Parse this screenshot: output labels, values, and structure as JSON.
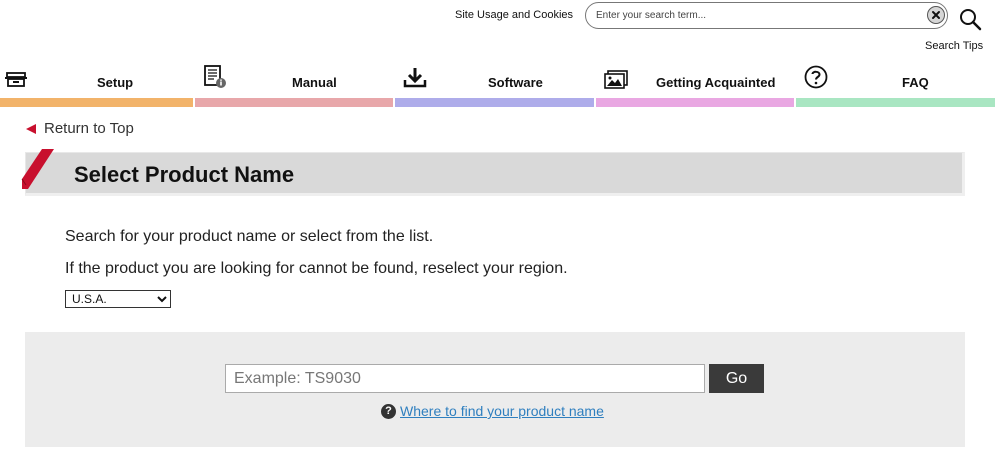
{
  "header": {
    "site_usage_link": "Site Usage and Cookies",
    "search_placeholder": "Enter your search term...",
    "search_tips": "Search Tips"
  },
  "nav": {
    "items": [
      {
        "label": "Setup",
        "icon": "printer-setup-icon",
        "color": "#f2b36a"
      },
      {
        "label": "Manual",
        "icon": "document-info-icon",
        "color": "#e8a7aa"
      },
      {
        "label": "Software",
        "icon": "download-icon",
        "color": "#aeacea"
      },
      {
        "label": "Getting Acquainted",
        "icon": "photo-icon",
        "color": "#e9a7e2"
      },
      {
        "label": "FAQ",
        "icon": "question-circle-icon",
        "color": "#a9e6c2"
      }
    ]
  },
  "return_to_top": "Return to Top",
  "page_title": "Select Product Name",
  "intro": {
    "line1": "Search for your product name or select from the list.",
    "line2": "If the product you are looking for cannot be found, reselect your region."
  },
  "region_select": {
    "value": "U.S.A."
  },
  "product_search": {
    "placeholder": "Example: TS9030",
    "go_label": "Go",
    "help_link": "Where to find your product name"
  },
  "colors": {
    "accent_red": "#c8102e",
    "link_blue": "#2f7fbf"
  }
}
